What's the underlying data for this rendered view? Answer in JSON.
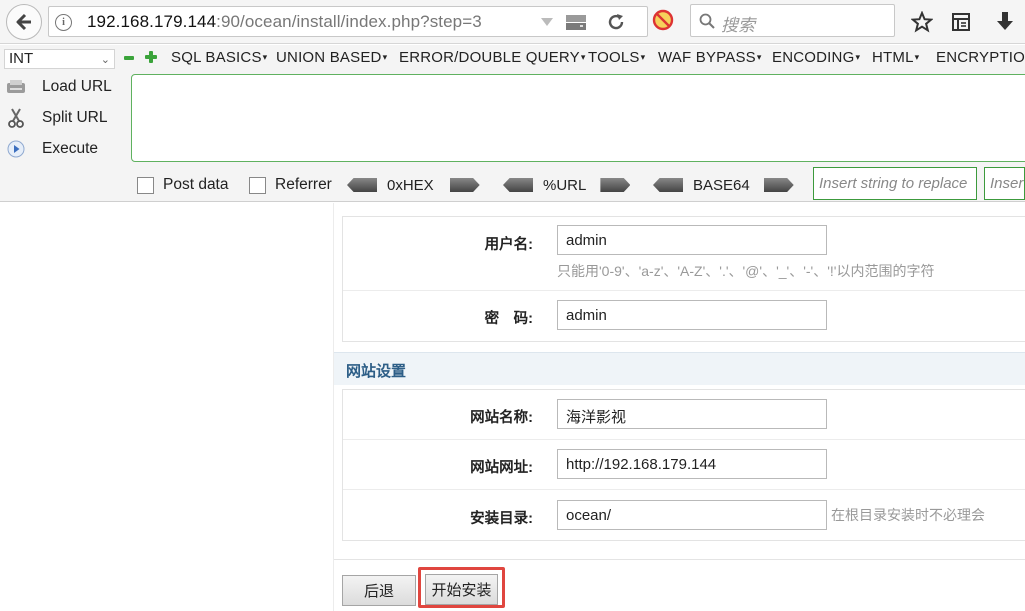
{
  "browser": {
    "url_host": "192.168.179.144",
    "url_rest": ":90/ocean/install/index.php?step=3",
    "search_placeholder": "搜索"
  },
  "hackbar": {
    "type_select": "INT",
    "menus": [
      "SQL BASICS",
      "UNION BASED",
      "ERROR/DOUBLE QUERY",
      "TOOLS",
      "WAF BYPASS",
      "ENCODING",
      "HTML",
      "ENCRYPTION"
    ],
    "load_url": "Load URL",
    "split_url": "Split URL",
    "execute": "Execute",
    "url_value": "",
    "post_data": "Post data",
    "referrer": "Referrer",
    "hex": "0xHEX",
    "urlenc": "%URL",
    "base64": "BASE64",
    "insert_placeholder": "Insert string to replace",
    "insert_placeholder2": "Insert"
  },
  "form": {
    "username_label": "用户名:",
    "username_value": "admin",
    "username_hint": "只能用'0-9'、'a-z'、'A-Z'、'.'、'@'、'_'、'-'、'!'以内范围的字符",
    "password_label": "密　码:",
    "password_value": "admin",
    "section_title": "网站设置",
    "sitename_label": "网站名称:",
    "sitename_value": "海洋影视",
    "siteurl_label": "网站网址:",
    "siteurl_value": "http://192.168.179.144",
    "dir_label": "安装目录:",
    "dir_value": "ocean/",
    "dir_hint": "在根目录安装时不必理会"
  },
  "buttons": {
    "back": "后退",
    "install": "开始安装"
  },
  "colors": {
    "highlight": "#e0463f",
    "section_text": "#2d5e87",
    "hackbar_green": "#3c9a3c"
  }
}
